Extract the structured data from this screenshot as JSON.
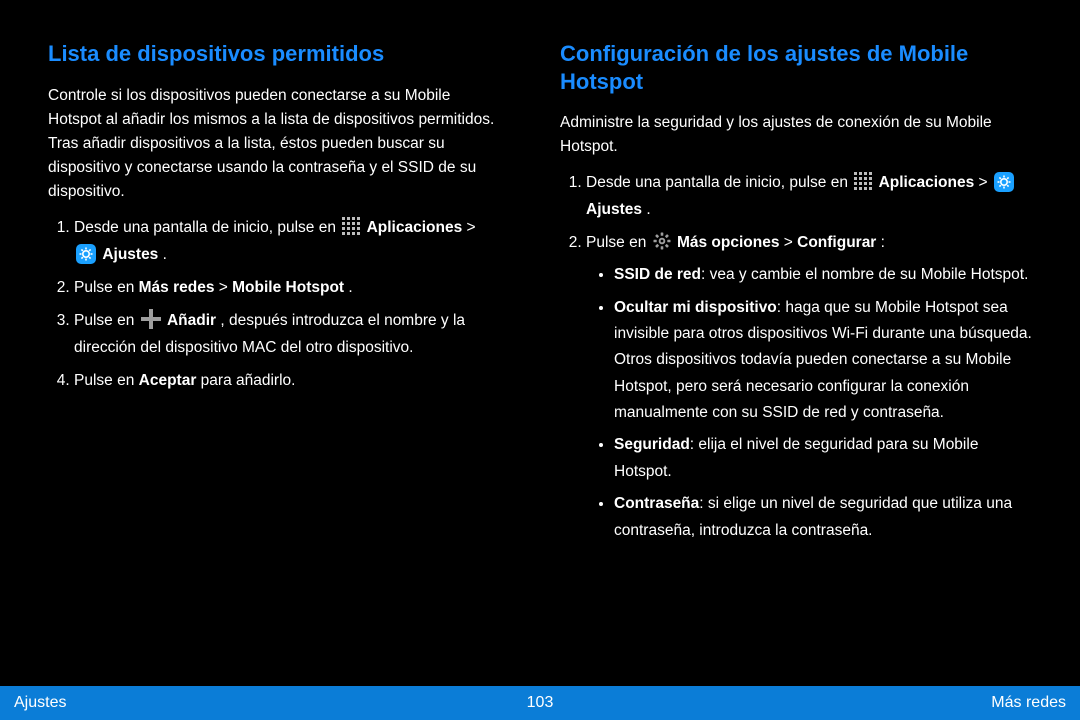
{
  "left": {
    "title": "Lista de dispositivos permitidos",
    "intro": "Controle si los dispositivos pueden conectarse a su Mobile Hotspot al añadir los mismos a la lista de dispositivos permitidos. Tras añadir dispositivos a la lista, éstos pueden buscar su dispositivo y conectarse usando la contraseña y el SSID de su dispositivo.",
    "step1_prefix": "Desde una pantalla de inicio, pulse en ",
    "step1_apps_label": "Aplicaciones",
    "step1_mid": " > ",
    "step1_settings_label": "Ajustes",
    "step1_end": ".",
    "step2_prefix": "Pulse en ",
    "step2_bold1": "Más redes",
    "step2_mid": " > ",
    "step2_bold2": "Mobile Hotspot",
    "step2_end": ".",
    "step3_prefix": "Pulse en ",
    "step3_add_label": "Añadir",
    "step3_mid": ", después introduzca el nombre y la dirección del dispositivo MAC del otro dispositivo.",
    "step4_prefix": "Pulse en ",
    "step4_bold": "Aceptar",
    "step4_end": " para añadirlo."
  },
  "right": {
    "title": "Configuración de los ajustes de Mobile Hotspot",
    "intro": "Administre la seguridad y los ajustes de conexión de su Mobile Hotspot.",
    "step1_prefix": "Desde una pantalla de inicio, pulse en ",
    "step1_apps_label": "Aplicaciones",
    "step1_mid": " > ",
    "step1_settings_label": "Ajustes",
    "step1_end": ".",
    "step2_prefix": "Pulse en ",
    "step2_more_label": "Más opciones",
    "step2_mid": " > ",
    "step2_bold": "Configurar",
    "step2_end": ":",
    "bullets": [
      {
        "bold": "SSID de red",
        "rest": ": vea y cambie el nombre de su Mobile Hotspot."
      },
      {
        "bold": "Ocultar mi dispositivo",
        "rest": ": haga que su Mobile Hotspot sea invisible para otros dispositivos Wi-Fi durante una búsqueda. Otros dispositivos todavía pueden conectarse a su Mobile Hotspot, pero será necesario configurar la conexión manualmente con su SSID de red y contraseña."
      },
      {
        "bold": "Seguridad",
        "rest": ": elija el nivel de seguridad para su Mobile Hotspot."
      },
      {
        "bold": "Contraseña",
        "rest": ": si elige un nivel de seguridad que utiliza una contraseña, introduzca la contraseña."
      }
    ]
  },
  "footer": {
    "left": "Ajustes",
    "page": "103",
    "right": "Más redes"
  }
}
